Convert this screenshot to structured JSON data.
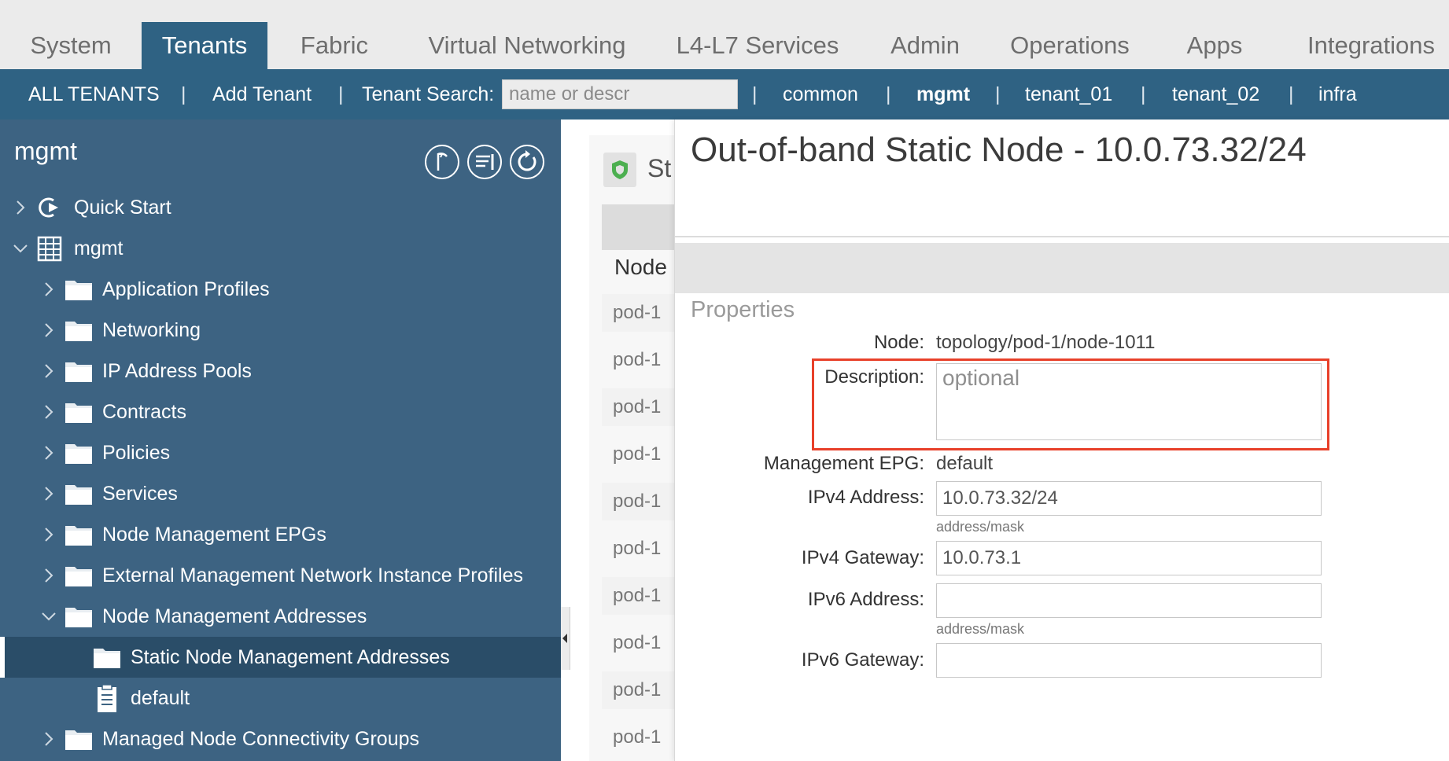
{
  "topnav": {
    "tabs": [
      {
        "label": "System"
      },
      {
        "label": "Tenants",
        "active": true
      },
      {
        "label": "Fabric"
      },
      {
        "label": "Virtual Networking"
      },
      {
        "label": "L4-L7 Services"
      },
      {
        "label": "Admin"
      },
      {
        "label": "Operations"
      },
      {
        "label": "Apps"
      },
      {
        "label": "Integrations"
      }
    ]
  },
  "subnav": {
    "all_tenants": "ALL TENANTS",
    "separator": "|",
    "add_tenant": "Add Tenant",
    "search_label": "Tenant Search:",
    "search_placeholder": "name or descr",
    "tenants": [
      "common",
      "mgmt",
      "tenant_01",
      "tenant_02",
      "infra"
    ],
    "current_tenant": "mgmt"
  },
  "sidebar": {
    "title": "mgmt",
    "header_icons": [
      "quick-flag-icon",
      "list-filter-icon",
      "refresh-icon"
    ],
    "tree": [
      {
        "label": "Quick Start",
        "icon": "quick-start-icon",
        "expanded": false
      },
      {
        "label": "mgmt",
        "icon": "building-icon",
        "expanded": true
      },
      {
        "label": "Application Profiles",
        "icon": "folder-icon",
        "expanded": false
      },
      {
        "label": "Networking",
        "icon": "folder-icon",
        "expanded": false
      },
      {
        "label": "IP Address Pools",
        "icon": "folder-icon",
        "expanded": false
      },
      {
        "label": "Contracts",
        "icon": "folder-icon",
        "expanded": false
      },
      {
        "label": "Policies",
        "icon": "folder-icon",
        "expanded": false
      },
      {
        "label": "Services",
        "icon": "folder-icon",
        "expanded": false
      },
      {
        "label": "Node Management EPGs",
        "icon": "folder-icon",
        "expanded": false
      },
      {
        "label": "External Management Network Instance Profiles",
        "icon": "folder-icon",
        "expanded": false
      },
      {
        "label": "Node Management Addresses",
        "icon": "folder-icon",
        "expanded": true
      },
      {
        "label": "Static Node Management Addresses",
        "icon": "folder-icon",
        "selected": true
      },
      {
        "label": "default",
        "icon": "document-icon"
      },
      {
        "label": "Managed Node Connectivity Groups",
        "icon": "folder-icon",
        "expanded": false
      }
    ]
  },
  "midpanel": {
    "heading_partial": "St",
    "column_header": "Node",
    "rows": [
      "pod-1",
      "pod-1",
      "pod-1",
      "pod-1",
      "pod-1",
      "pod-1",
      "pod-1",
      "pod-1",
      "pod-1",
      "pod-1"
    ]
  },
  "detail": {
    "title": "Out-of-band Static Node - 10.0.73.32/24",
    "section": "Properties",
    "node_label": "Node:",
    "node_value": "topology/pod-1/node-1011",
    "description_label": "Description:",
    "description_placeholder": "optional",
    "epg_label": "Management EPG:",
    "epg_value": "default",
    "ipv4_address_label": "IPv4 Address:",
    "ipv4_address_value": "10.0.73.32/24",
    "ipv4_address_hint": "address/mask",
    "ipv4_gateway_label": "IPv4 Gateway:",
    "ipv4_gateway_value": "10.0.73.1",
    "ipv6_address_label": "IPv6 Address:",
    "ipv6_address_value": "",
    "ipv6_address_hint": "address/mask",
    "ipv6_gateway_label": "IPv6 Gateway:",
    "ipv6_gateway_value": ""
  },
  "colors": {
    "nav_blue": "#2f6283",
    "sidebar_blue": "#3d6382",
    "selected_row": "#2a4d68",
    "highlight_red": "#e8402a"
  }
}
